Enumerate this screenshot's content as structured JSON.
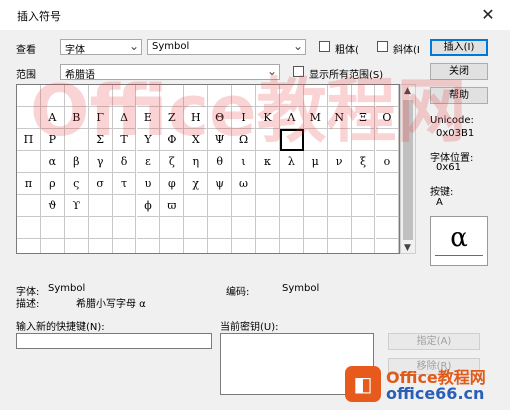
{
  "window": {
    "title": "插入符号",
    "close_glyph": "✕"
  },
  "font_label": "查看",
  "font_type": "字体",
  "font_name": "Symbol",
  "bold_label": "粗体(",
  "italic_label": "斜体(I",
  "range_label": "范围",
  "range_value": "希腊语",
  "show_all_label": "显示所有范围(S)",
  "buttons": {
    "insert": "插入(I)",
    "close": "关闭",
    "help": "帮助",
    "assign": "指定(A)",
    "remove": "移除(R)"
  },
  "unicode": {
    "label": "Unicode:",
    "value": "0x03B1"
  },
  "charpos": {
    "label": "字体位置:",
    "value": "0x61"
  },
  "keys": {
    "label": "按键:",
    "value": "A"
  },
  "preview_char": "α",
  "selected_index": 43,
  "symbols": [
    "",
    "",
    "",
    "",
    "",
    "",
    "",
    "",
    "",
    "",
    "",
    "",
    "",
    "",
    "",
    "",
    "",
    "Α",
    "Β",
    "Γ",
    "Δ",
    "Ε",
    "Ζ",
    "Η",
    "Θ",
    "Ι",
    "Κ",
    "Λ",
    "Μ",
    "Ν",
    "Ξ",
    "Ο",
    "Π",
    "Ρ",
    "",
    "Σ",
    "Τ",
    "Υ",
    "Φ",
    "Χ",
    "Ψ",
    "Ω",
    "",
    "",
    "",
    "",
    "",
    "",
    "",
    "α",
    "β",
    "γ",
    "δ",
    "ε",
    "ζ",
    "η",
    "θ",
    "ι",
    "κ",
    "λ",
    "μ",
    "ν",
    "ξ",
    "ο",
    "π",
    "ρ",
    "ς",
    "σ",
    "τ",
    "υ",
    "φ",
    "χ",
    "ψ",
    "ω",
    "",
    "",
    "",
    "",
    "",
    "",
    "",
    "ϑ",
    "ϒ",
    "",
    "",
    "ϕ",
    "ϖ",
    "",
    "",
    "",
    "",
    "",
    "",
    "",
    "",
    "",
    "",
    "",
    "",
    "",
    "",
    "",
    "",
    "",
    "",
    "",
    "",
    "",
    "",
    "",
    "",
    "",
    "",
    "",
    "",
    "",
    "",
    "",
    "",
    "",
    "",
    "",
    "",
    "",
    "",
    "",
    "",
    ""
  ],
  "info": {
    "font_label": "字体:",
    "font_value": "Symbol",
    "code_label": "编码:",
    "code_value": "Symbol",
    "desc_label": "描述:",
    "desc_value": "希腊小写字母 α"
  },
  "shortcut_new_label": "输入新的快捷键(N):",
  "shortcut_current_label": "当前密钥(U):",
  "watermark_text": "Office教程网",
  "watermark_logo": "Office教程网",
  "watermark_url": "office66.cn"
}
